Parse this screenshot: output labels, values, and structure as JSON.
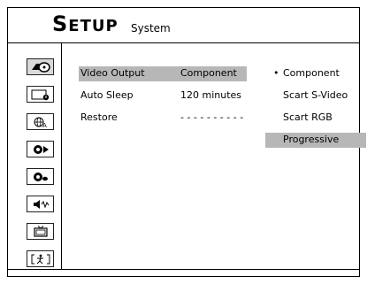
{
  "header": {
    "title_big": "S",
    "title_rest": "ETUP",
    "subtitle": "System"
  },
  "sidebar": {
    "items": [
      {
        "icon": "disc-settings-icon",
        "active": true
      },
      {
        "icon": "screen-icon",
        "active": false
      },
      {
        "icon": "language-globe-icon",
        "active": false
      },
      {
        "icon": "playback-icon",
        "active": false
      },
      {
        "icon": "audio-disc-icon",
        "active": false
      },
      {
        "icon": "speaker-icon",
        "active": false
      },
      {
        "icon": "tv-icon",
        "active": false
      },
      {
        "icon": "exit-icon",
        "active": false
      }
    ]
  },
  "settings": {
    "rows": [
      {
        "label": "Video Output",
        "value": "Component"
      },
      {
        "label": "Auto Sleep",
        "value": "120 minutes"
      },
      {
        "label": "Restore",
        "value": "- - - - - - - - - -"
      }
    ]
  },
  "options": {
    "items": [
      {
        "label": "Component",
        "marker": "•"
      },
      {
        "label": "Scart S-Video",
        "marker": ""
      },
      {
        "label": "Scart RGB",
        "marker": ""
      },
      {
        "label": "Progressive",
        "marker": ""
      }
    ]
  },
  "colors": {
    "selection": "#b7b7b7",
    "active_icon": "#d9d9d9"
  }
}
